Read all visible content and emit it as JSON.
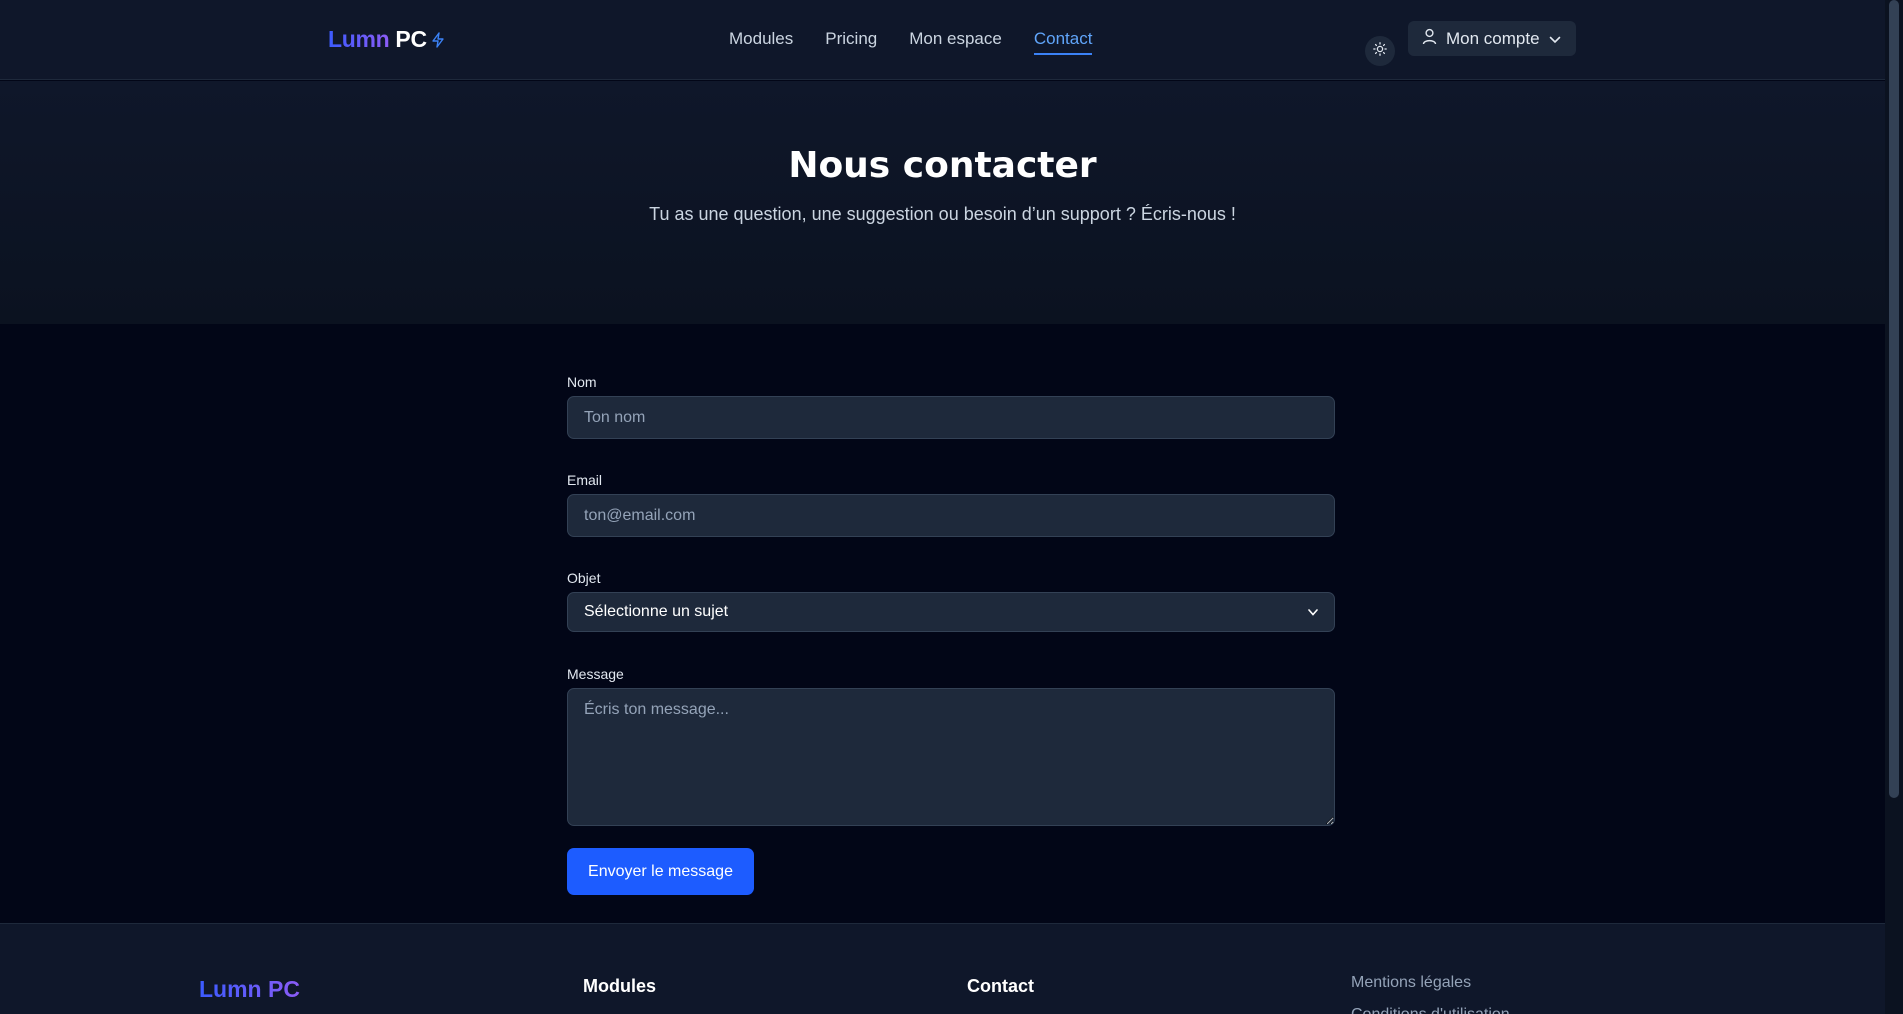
{
  "header": {
    "logo_lumn": "Lumn",
    "logo_pc": "PC",
    "nav": [
      "Modules",
      "Pricing",
      "Mon espace",
      "Contact"
    ],
    "active_nav": "Contact",
    "account_label": "Mon compte"
  },
  "hero": {
    "title": "Nous contacter",
    "subtitle": "Tu as une question, une suggestion ou besoin d’un support ? Écris-nous !"
  },
  "form": {
    "name_label": "Nom",
    "name_placeholder": "Ton nom",
    "email_label": "Email",
    "email_placeholder": "ton@email.com",
    "subject_label": "Objet",
    "subject_selected": "Sélectionne un sujet",
    "message_label": "Message",
    "message_placeholder": "Écris ton message...",
    "submit_label": "Envoyer le message"
  },
  "footer": {
    "logo": "Lumn PC",
    "col_modules": "Modules",
    "col_contact": "Contact",
    "legal_link": "Mentions légales",
    "terms_link": "Conditions d'utilisation"
  },
  "colors": {
    "accent": "#1d5cff",
    "active_link": "#60a5fa",
    "background": "#020617",
    "header_bg": "#0f172a",
    "input_bg": "#1e293b"
  }
}
